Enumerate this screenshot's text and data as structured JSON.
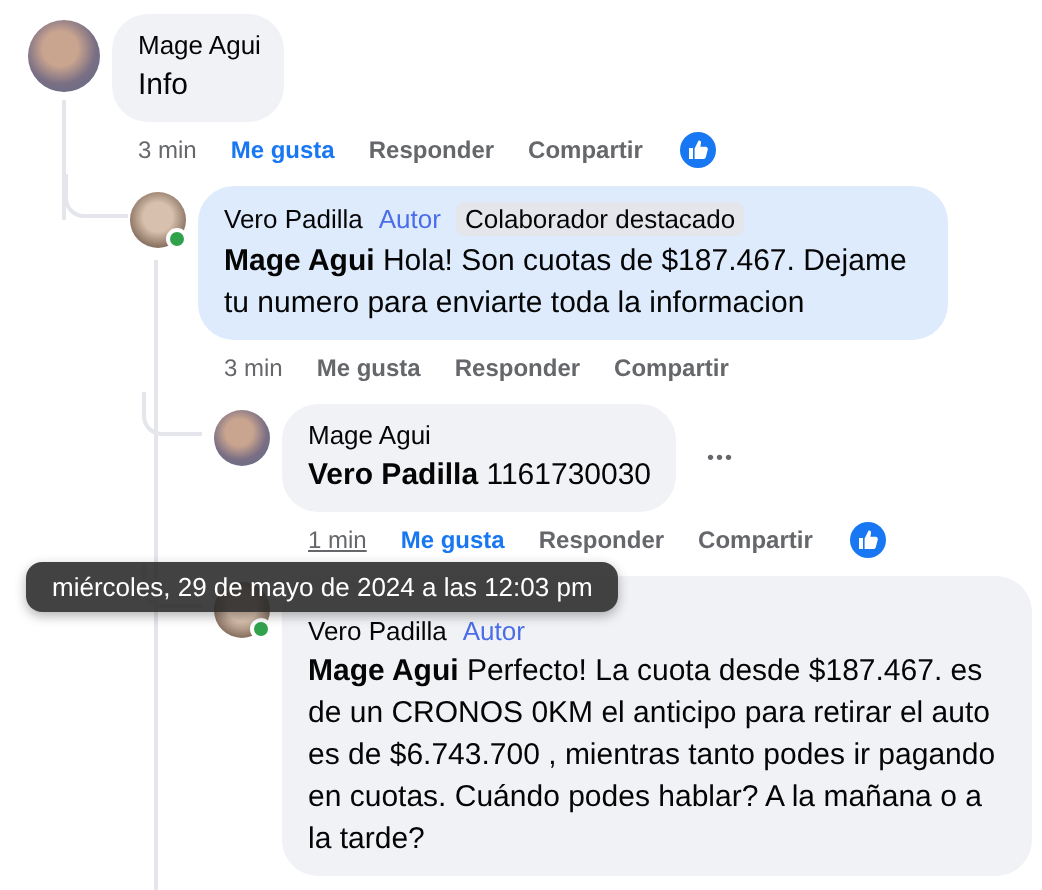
{
  "comments": [
    {
      "author": "Mage Agui",
      "text": "Info",
      "time": "3 min",
      "time_hovered": false,
      "actions": [
        "Me gusta",
        "Responder",
        "Compartir"
      ],
      "liked": true,
      "reaction": true,
      "children": [
        {
          "author": "Vero Padilla",
          "badges": [
            "Autor",
            "Colaborador destacado"
          ],
          "mention": "Mage Agui",
          "text": "Hola! Son cuotas de $187.467. Dejame tu numero para enviarte toda la informacion",
          "highlighted": true,
          "online": true,
          "time": "3 min",
          "time_hovered": false,
          "actions": [
            "Me gusta",
            "Responder",
            "Compartir"
          ],
          "liked": false,
          "children": [
            {
              "author": "Mage Agui",
              "mention": "Vero Padilla",
              "text": "1161730030",
              "more_menu": "•••",
              "time": "1 min",
              "time_hovered": true,
              "tooltip": "miércoles, 29 de mayo de 2024 a las 12:03 pm",
              "actions": [
                "Me gusta",
                "Responder",
                "Compartir"
              ],
              "liked": true,
              "reaction": true
            },
            {
              "author": "Vero Padilla",
              "badges": [
                "Autor"
              ],
              "mention": "Mage Agui",
              "text": "Perfecto! La cuota desde $187.467. es de un CRONOS 0KM el anticipo para retirar el auto es de $6.743.700 , mientras tanto podes ir pagando en cuotas. Cuándo podes hablar? A la mañana o a la tarde?",
              "online": true
            }
          ]
        }
      ]
    }
  ]
}
